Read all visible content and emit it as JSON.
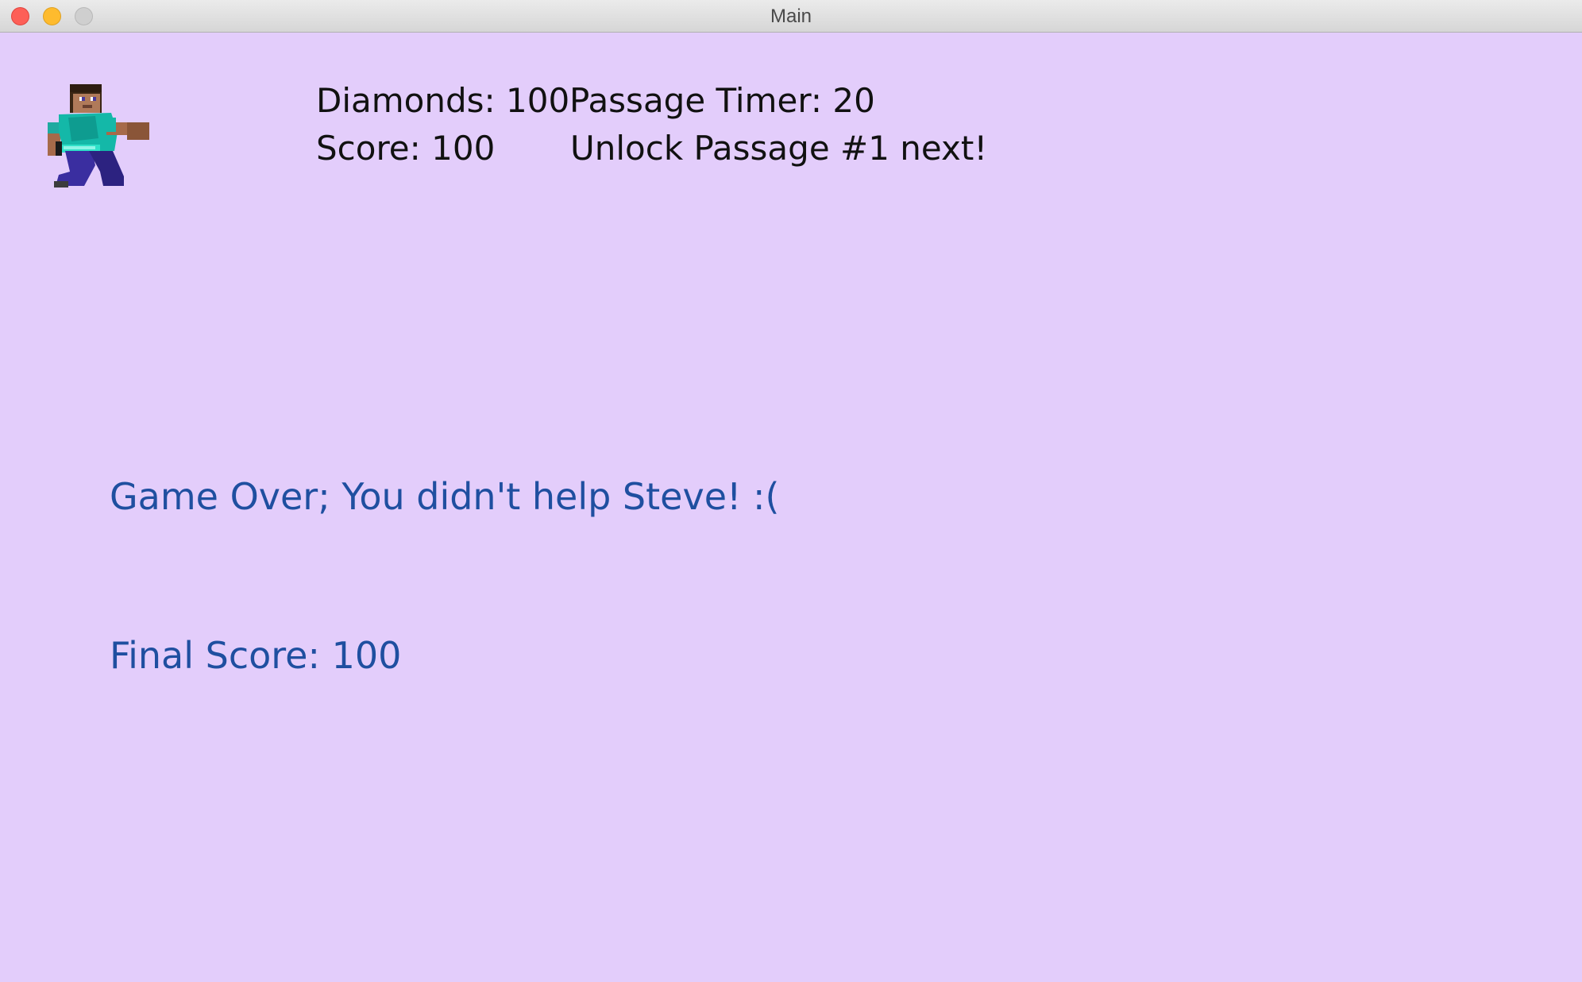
{
  "window": {
    "title": "Main"
  },
  "hud": {
    "diamonds_text": "Diamonds: 100",
    "passage_timer_text": "Passage Timer: 20",
    "score_text": "Score: 100",
    "next_goal_text": "Unlock Passage #1 next!"
  },
  "game_over": {
    "message": "Game Over; You didn't help Steve! :(",
    "final_score_text": "Final Score: 100"
  },
  "player": {
    "icon": "steve-character-icon"
  },
  "colors": {
    "background": "#e3cdfb",
    "hud_text": "#111111",
    "message_text": "#1f4fa0"
  }
}
